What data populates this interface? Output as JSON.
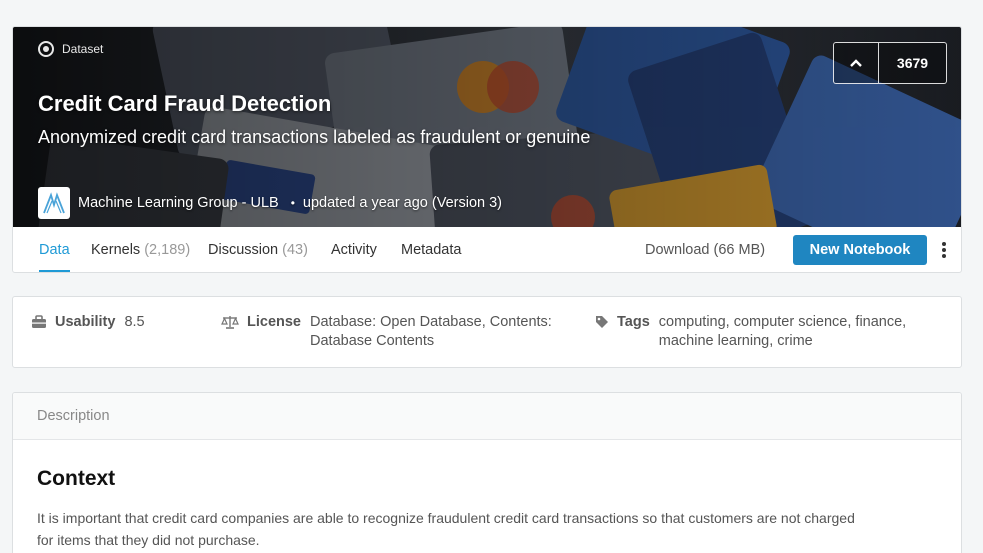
{
  "header": {
    "type_label": "Dataset",
    "title": "Credit Card Fraud Detection",
    "subtitle": "Anonymized credit card transactions labeled as fraudulent or genuine",
    "owner": "Machine Learning Group - ULB",
    "separator": "•",
    "updated": "updated a year ago (Version 3)",
    "vote_count": "3679"
  },
  "tabs": [
    {
      "label": "Data",
      "count": ""
    },
    {
      "label": "Kernels",
      "count": "(2,189)"
    },
    {
      "label": "Discussion",
      "count": "(43)"
    },
    {
      "label": "Activity",
      "count": ""
    },
    {
      "label": "Metadata",
      "count": ""
    }
  ],
  "actions": {
    "download": "Download (66 MB)",
    "new_notebook": "New Notebook"
  },
  "meta": {
    "usability_label": "Usability",
    "usability_value": "8.5",
    "license_label": "License",
    "license_value_1": "Database: Open Database, Contents:",
    "license_value_2": "Database Contents",
    "tags_label": "Tags",
    "tags_value_1": "computing, computer science, finance,",
    "tags_value_2": "machine learning, crime"
  },
  "description": {
    "heading": "Description",
    "section_title": "Context",
    "text_1": "It is important that credit card companies are able to recognize fraudulent credit card transactions so that customers are not charged",
    "text_2": "for items that they did not purchase."
  },
  "colors": {
    "accent": "#1f9ad6",
    "button": "#1f86c1"
  }
}
